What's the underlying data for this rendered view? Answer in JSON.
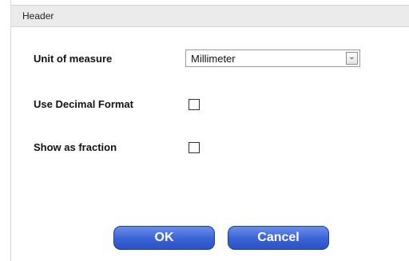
{
  "header": {
    "title": "Header"
  },
  "form": {
    "unit_label": "Unit of measure",
    "unit_value": "Millimeter",
    "decimal_label": "Use Decimal Format",
    "decimal_checked": false,
    "fraction_label": "Show as fraction",
    "fraction_checked": false
  },
  "buttons": {
    "ok": "OK",
    "cancel": "Cancel"
  },
  "colors": {
    "button_blue": "#3a62d6",
    "header_bg": "#ebebeb"
  }
}
